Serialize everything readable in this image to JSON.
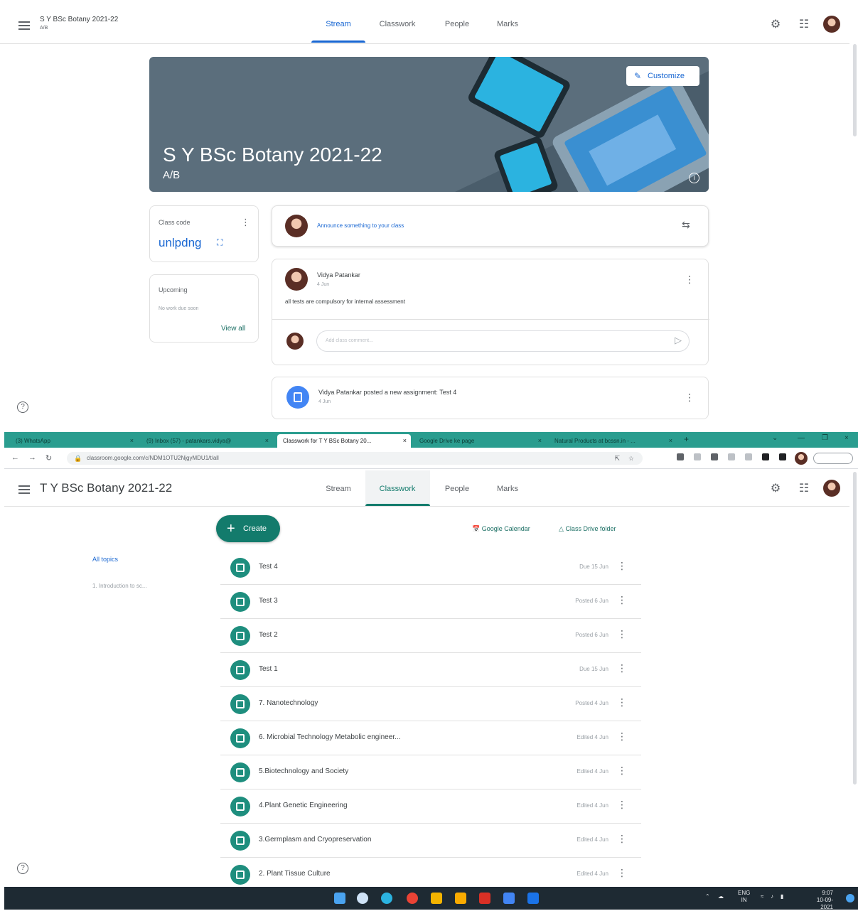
{
  "top": {
    "class_title": "S Y BSc Botany 2021-22",
    "class_sub": "A/B",
    "tabs": [
      "Stream",
      "Classwork",
      "People",
      "Marks"
    ],
    "active_tab": "Stream",
    "customize": "Customize",
    "class_code_label": "Class code",
    "class_code": "unlpdng",
    "announce_placeholder": "Announce something to your class",
    "upcoming_label": "Upcoming",
    "upcoming_text": "No work due soon",
    "view_all": "View all",
    "post_author": "Vidya Patankar",
    "post_date": "4 Jun",
    "post_text": "all tests are compulsory for internal assessment",
    "comment_placeholder": "Add class comment...",
    "assignment_text": "Vidya Patankar posted a new assignment: Test 4",
    "assignment_date": "4 Jun"
  },
  "browser": {
    "tabs": [
      {
        "label": "(3) WhatsApp"
      },
      {
        "label": "(9) Inbox (57) - patankars.vidya@"
      },
      {
        "label": "Classwork for T Y BSc Botany 20..."
      },
      {
        "label": "Google Drive ke page"
      },
      {
        "label": "Natural Products at bcssn.in - ..."
      }
    ],
    "active_tab_index": 2,
    "url": "classroom.google.com/c/NDM1OTU2NjgyMDU1/t/all"
  },
  "classwork": {
    "class_title": "T Y BSc Botany 2021-22",
    "tabs": [
      "Stream",
      "Classwork",
      "People",
      "Marks"
    ],
    "active_tab": "Classwork",
    "create": "Create",
    "google_calendar": "Google Calendar",
    "drive_folder": "Class Drive folder",
    "topics": [
      "All topics",
      "1. Introduction to sc..."
    ],
    "items": [
      {
        "title": "Test 4",
        "date": "Due 15 Jun"
      },
      {
        "title": "Test 3",
        "date": "Posted 6 Jun"
      },
      {
        "title": "Test 2",
        "date": "Posted 6 Jun"
      },
      {
        "title": "Test 1",
        "date": "Due 15 Jun"
      },
      {
        "title": "7. Nanotechnology",
        "date": "Posted 4 Jun"
      },
      {
        "title": "6. Microbial Technology Metabolic engineer...",
        "date": "Edited 4 Jun"
      },
      {
        "title": "5.Biotechnology and Society",
        "date": "Edited 4 Jun"
      },
      {
        "title": "4.Plant Genetic Engineering",
        "date": "Edited 4 Jun"
      },
      {
        "title": "3.Germplasm and Cryopreservation",
        "date": "Edited 4 Jun"
      },
      {
        "title": "2. Plant Tissue Culture",
        "date": "Edited 4 Jun"
      }
    ]
  },
  "taskbar": {
    "lang": "ENG",
    "lang2": "IN",
    "time": "9:07",
    "date": "10-09-2021"
  },
  "colors": {
    "accent_blue": "#1967d2",
    "accent_teal": "#137b6c",
    "banner": "#5b6e7c",
    "tabstrip": "#2a9d8f",
    "taskbar": "#1e2a33"
  }
}
